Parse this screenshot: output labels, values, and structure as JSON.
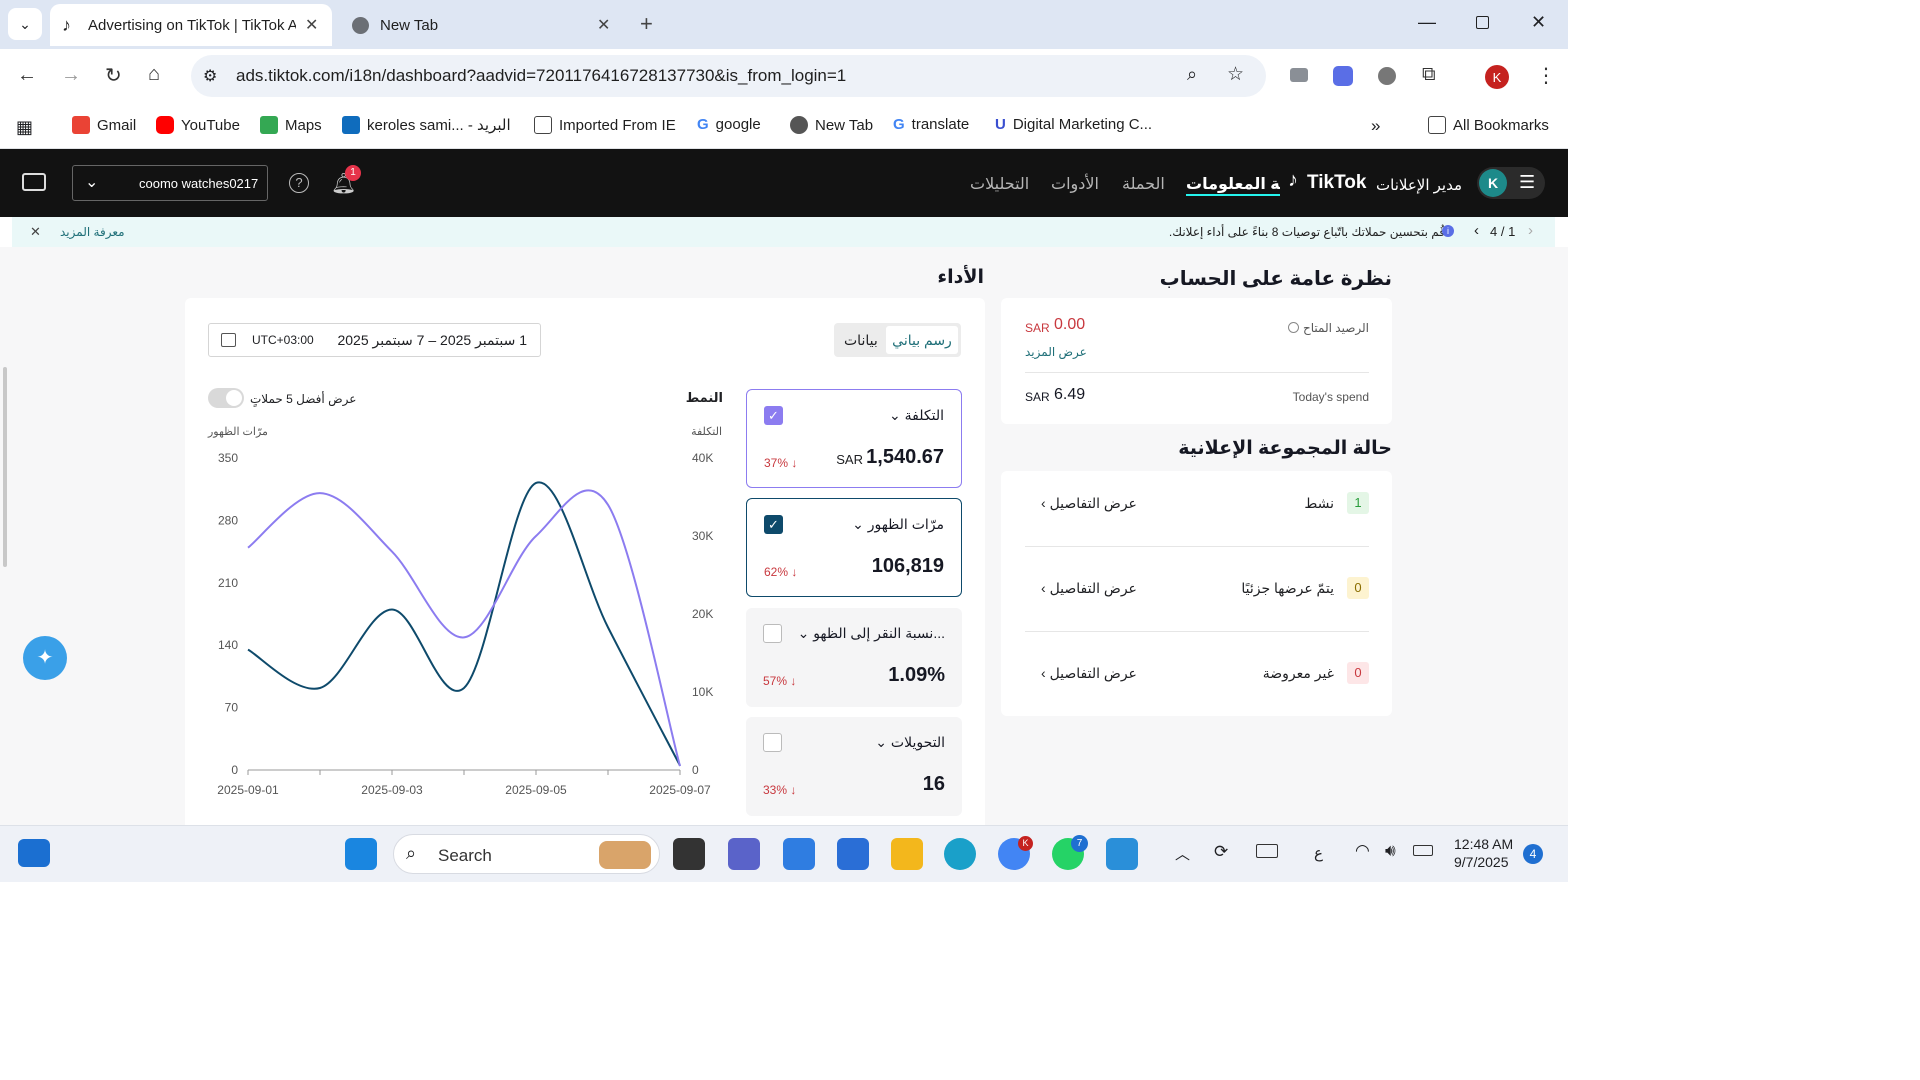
{
  "browser": {
    "tabs": [
      {
        "title": "Advertising on TikTok | TikTok A",
        "active": true
      },
      {
        "title": "New Tab",
        "active": false
      }
    ],
    "url": "ads.tiktok.com/i18n/dashboard?aadvid=7201176416728137730&is_from_login=1",
    "profile_initial": "K",
    "bookmarks": [
      "Gmail",
      "YouTube",
      "Maps",
      "keroles sami... - البريد",
      "Imported From IE",
      "google",
      "New Tab",
      "translate",
      "Digital Marketing C...",
      "All Bookmarks"
    ]
  },
  "app": {
    "brand": "TikTok",
    "brand_sub": "مدير الإعلانات",
    "avatar": "K",
    "nav": [
      "لوحة المعلومات",
      "الحملة",
      "الأدوات",
      "التحليلات"
    ],
    "account": "coomo watches0217",
    "notif_count": "1"
  },
  "banner": {
    "pager": "4 / 1",
    "text": "قُم بتحسين حملاتك باتّباع توصيات 8 بناءً على أداء إعلانك.",
    "learn_more": "معرفة المزيد"
  },
  "overview": {
    "title": "نظرة عامة على الحساب",
    "balance_label": "الرصيد المتاح",
    "balance_value": "0.00",
    "balance_currency": "SAR",
    "view_more": "عرض المزيد",
    "spend_label": "Today's spend",
    "spend_value": "6.49",
    "spend_currency": "SAR"
  },
  "adgroup_status": {
    "title": "حالة المجموعة الإعلانية",
    "details_label": "عرض التفاصيل",
    "rows": [
      {
        "label": "نشط",
        "count": "1",
        "color": "#2a9d3c",
        "bg": "#e4f6e6"
      },
      {
        "label": "يتمّ عرضها جزئيًا",
        "count": "0",
        "color": "#8a6d00",
        "bg": "#fdf3d0"
      },
      {
        "label": "غير معروضة",
        "count": "0",
        "color": "#c8383e",
        "bg": "#fde6e7"
      }
    ]
  },
  "performance": {
    "title": "الأداء",
    "view_tabs": [
      "رسم بياني",
      "بيانات"
    ],
    "date_range": "1 سبتمبر 2025 – 7 سبتمبر 2025",
    "timezone": "UTC+03:00",
    "mode_label": "النمط",
    "top5_label": "عرض أفضل 5 حملاتٍ",
    "metrics": [
      {
        "title": "التكلفة",
        "value": "1,540.67",
        "currency": "SAR",
        "pct": "37% ↓",
        "checked": true,
        "color": "#8c7cf0"
      },
      {
        "title": "مرّات الظهور",
        "value": "106,819",
        "currency": "",
        "pct": "62% ↓",
        "checked": true,
        "color": "#0e4a6b"
      },
      {
        "title": "نسبة النقر إلى الظهو...",
        "value": "1.09%",
        "currency": "",
        "pct": "57% ↓",
        "checked": false,
        "color": ""
      },
      {
        "title": "التحويلات",
        "value": "16",
        "currency": "",
        "pct": "33% ↓",
        "checked": false,
        "color": ""
      }
    ]
  },
  "chart_data": {
    "type": "line",
    "x": [
      "2025-09-01",
      "2025-09-02",
      "2025-09-03",
      "2025-09-04",
      "2025-09-05",
      "2025-09-06",
      "2025-09-07"
    ],
    "x_tick_labels": [
      "2025-09-01",
      "2025-09-03",
      "2025-09-05",
      "2025-09-07"
    ],
    "left_axis": {
      "label": "مرّات الظهور",
      "ticks": [
        "0",
        "70",
        "140",
        "210",
        "280",
        "350"
      ],
      "ylim": [
        0,
        350
      ]
    },
    "right_axis": {
      "label": "التكلفة",
      "ticks": [
        "0",
        "10K",
        "20K",
        "30K",
        "40K"
      ],
      "ylim": [
        0,
        40000
      ]
    },
    "series": [
      {
        "name": "مرّات الظهور",
        "axis": "left",
        "color": "#0e4a6b",
        "values": [
          135,
          92,
          180,
          92,
          322,
          160,
          5
        ]
      },
      {
        "name": "التكلفة",
        "axis": "right",
        "color": "#8c7cf0",
        "values": [
          28500,
          35500,
          28000,
          17000,
          30000,
          34000,
          500
        ]
      }
    ],
    "grid": false
  },
  "taskbar": {
    "search_placeholder": "Search",
    "time": "12:48 AM",
    "date": "9/7/2025",
    "lang": "ع",
    "notif_count": "4",
    "chrome_badge": "K",
    "whatsapp_badge": "7"
  }
}
